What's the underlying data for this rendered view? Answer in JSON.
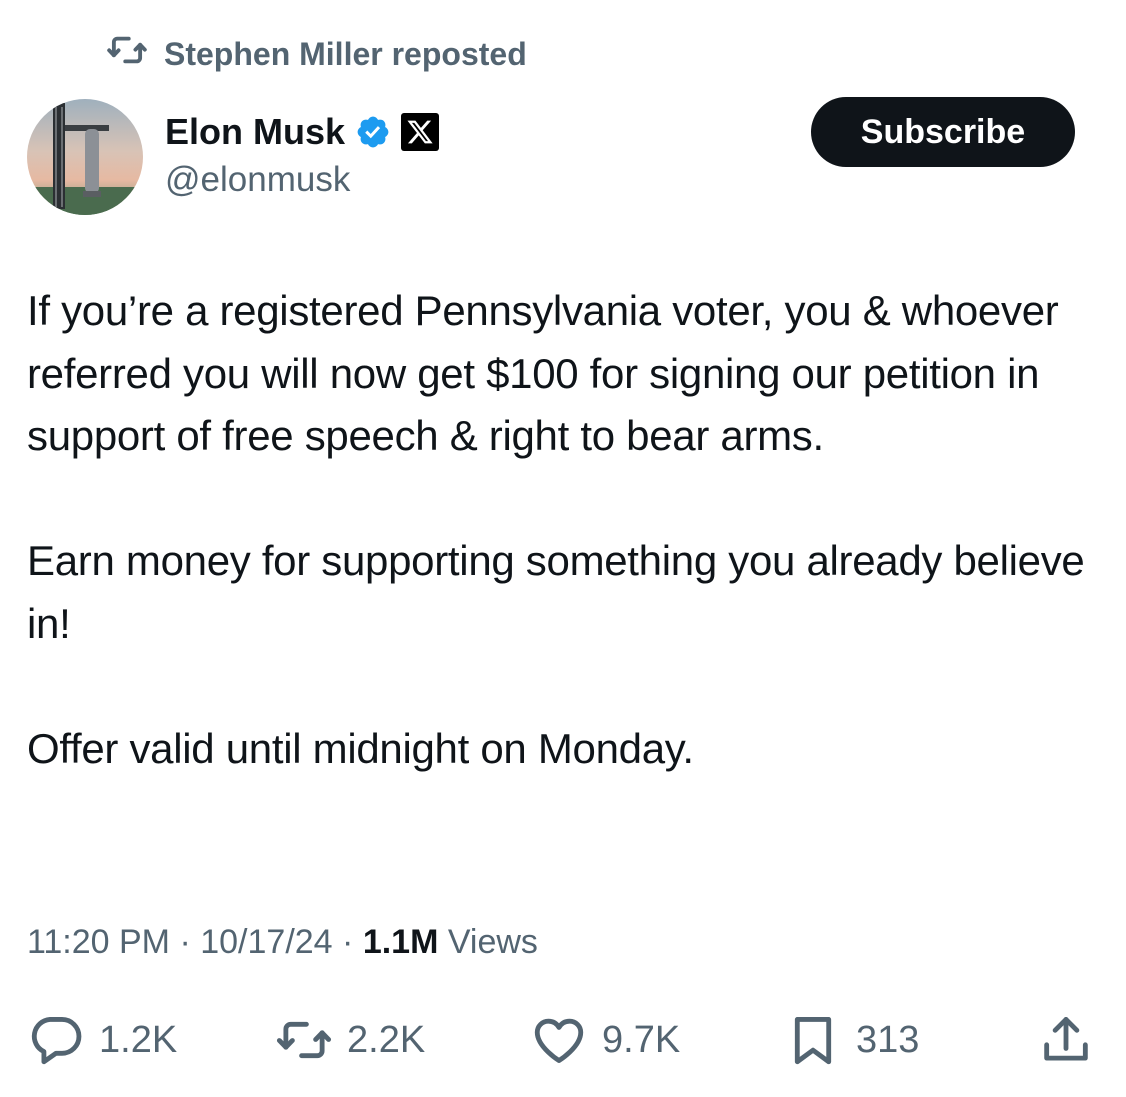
{
  "repost": {
    "icon": "repost-icon",
    "text": "Stephen Miller reposted"
  },
  "author": {
    "display_name": "Elon Musk",
    "handle": "@elonmusk",
    "verified_color": "#1d9bf0",
    "affiliate_badge": "x-logo-icon"
  },
  "subscribe_label": "Subscribe",
  "tweet": {
    "text": "If you’re a registered Pennsylvania voter, you & whoever referred you will now get $100 for signing our petition in support of free speech & right to bear arms.\n\nEarn money for supporting something you already believe in!\n\nOffer valid until midnight on Monday."
  },
  "meta": {
    "time": "11:20 PM",
    "separator": " · ",
    "date": "10/17/24",
    "views_count": "1.1M",
    "views_label": " Views"
  },
  "actions": {
    "replies": "1.2K",
    "reposts": "2.2K",
    "likes": "9.7K",
    "bookmarks": "313"
  },
  "colors": {
    "text_primary": "#0f1419",
    "text_secondary": "#536471",
    "verified": "#1d9bf0",
    "button_bg": "#0f1419"
  }
}
